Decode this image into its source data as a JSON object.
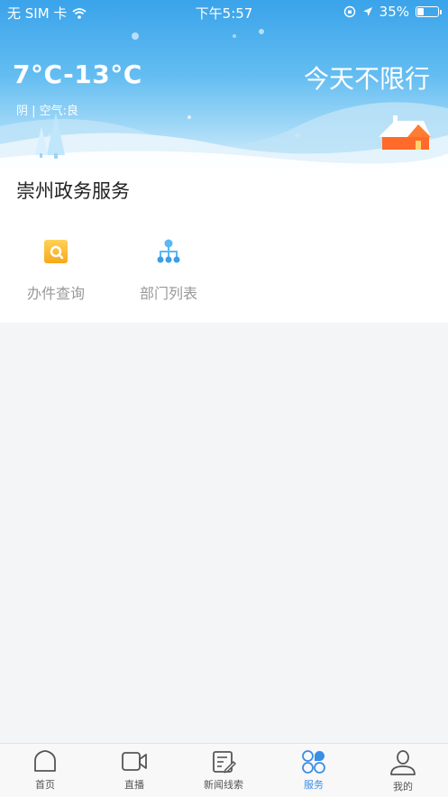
{
  "status_bar": {
    "carrier": "无 SIM 卡",
    "time": "下午5:57",
    "battery_percent": "35%",
    "battery_level": 0.35
  },
  "banner": {
    "temperature": "7°C-13°C",
    "restriction": "今天不限行",
    "weather": "阴 | 空气:良"
  },
  "services": {
    "title": "崇州政务服务",
    "items": [
      {
        "label": "办件查询",
        "icon": "search-document-icon"
      },
      {
        "label": "部门列表",
        "icon": "org-chart-icon"
      }
    ]
  },
  "tabbar": {
    "items": [
      {
        "label": "首页",
        "icon": "home-icon"
      },
      {
        "label": "直播",
        "icon": "video-camera-icon"
      },
      {
        "label": "新闻线索",
        "icon": "news-edit-icon"
      },
      {
        "label": "服务",
        "icon": "services-grid-icon"
      },
      {
        "label": "我的",
        "icon": "user-icon"
      }
    ],
    "active_index": 3,
    "active_color": "#3a8ee6"
  }
}
